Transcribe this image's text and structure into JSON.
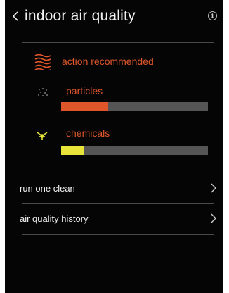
{
  "header": {
    "title": "indoor air quality",
    "back_icon": "chevron-left-icon",
    "info_icon": "info-icon",
    "info_glyph": "i"
  },
  "status": {
    "icon": "waves-icon",
    "text": "action recommended",
    "color": "#e0562b"
  },
  "metrics": [
    {
      "label": "particles",
      "icon": "particles-icon",
      "level": 0.32,
      "fill_color": "#e0562b"
    },
    {
      "label": "chemicals",
      "icon": "chemicals-icon",
      "level": 0.16,
      "fill_color": "#e8e43a"
    }
  ],
  "menu": [
    {
      "label": "run one clean",
      "icon": "chevron-right-icon"
    },
    {
      "label": "air quality history",
      "icon": "chevron-right-icon"
    }
  ],
  "colors": {
    "background": "#050505",
    "accent": "#e0562b",
    "bar_track": "#555555"
  }
}
